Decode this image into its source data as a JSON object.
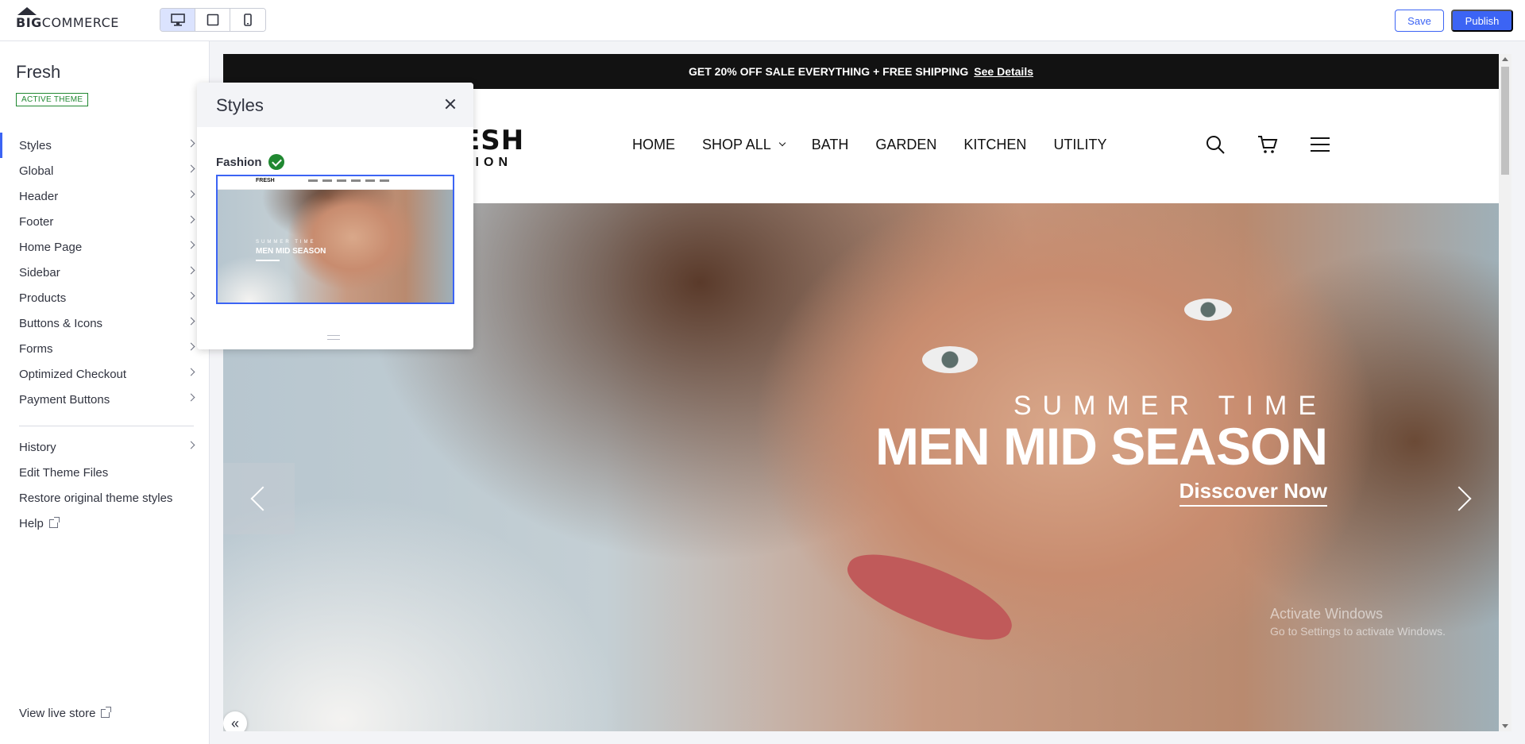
{
  "topbar": {
    "logo_prefix": "BIG",
    "logo_suffix": "COMMERCE",
    "device_modes": [
      "desktop",
      "tablet",
      "mobile"
    ],
    "active_device": "desktop",
    "save_label": "Save",
    "publish_label": "Publish",
    "accent_color": "#3c64f4"
  },
  "sidebar": {
    "theme_name": "Fresh",
    "active_badge": "ACTIVE THEME",
    "items": [
      {
        "label": "Styles"
      },
      {
        "label": "Global"
      },
      {
        "label": "Header"
      },
      {
        "label": "Footer"
      },
      {
        "label": "Home Page"
      },
      {
        "label": "Sidebar"
      },
      {
        "label": "Products"
      },
      {
        "label": "Buttons & Icons"
      },
      {
        "label": "Forms"
      },
      {
        "label": "Optimized Checkout"
      },
      {
        "label": "Payment Buttons"
      }
    ],
    "secondary_items": [
      {
        "label": "History"
      },
      {
        "label": "Edit Theme Files"
      },
      {
        "label": "Restore original theme styles"
      },
      {
        "label": "Help"
      }
    ],
    "view_live_store": "View live store"
  },
  "styles_panel": {
    "title": "Styles",
    "variation_name": "Fashion",
    "thumbnail": {
      "logo": "FRESH",
      "subtitle": "SUMMER TIME",
      "title": "MEN MID SEASON"
    }
  },
  "preview": {
    "promo": {
      "text": "GET 20% OFF SALE EVERYTHING + FREE SHIPPING",
      "link": "See Details"
    },
    "logo": "ESH",
    "logo_sub": "HION",
    "nav": [
      {
        "label": "HOME"
      },
      {
        "label": "SHOP ALL"
      },
      {
        "label": "BATH"
      },
      {
        "label": "GARDEN"
      },
      {
        "label": "KITCHEN"
      },
      {
        "label": "UTILITY"
      }
    ],
    "icons": [
      "search-icon",
      "cart-icon",
      "menu-icon"
    ],
    "hero": {
      "subtitle": "SUMMER TIME",
      "title": "MEN MID SEASON",
      "cta": "Disscover Now"
    },
    "watermark": {
      "line1": "Activate Windows",
      "line2": "Go to Settings to activate Windows."
    }
  }
}
